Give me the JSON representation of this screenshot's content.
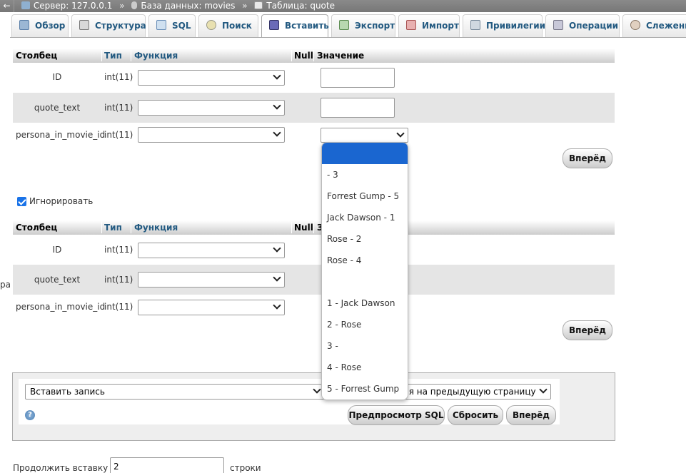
{
  "topbar": {
    "back": "←",
    "server": "Сервер: 127.0.0.1",
    "database": "База данных: movies",
    "table": "Таблица: quote",
    "sep": "»"
  },
  "tabs": [
    {
      "label": "Обзор",
      "icon": "browse-icon"
    },
    {
      "label": "Структура",
      "icon": "structure-icon"
    },
    {
      "label": "SQL",
      "icon": "sql-icon"
    },
    {
      "label": "Поиск",
      "icon": "search-icon"
    },
    {
      "label": "Вставить",
      "icon": "insert-icon"
    },
    {
      "label": "Экспорт",
      "icon": "export-icon"
    },
    {
      "label": "Импорт",
      "icon": "import-icon"
    },
    {
      "label": "Привилегии",
      "icon": "privileges-icon"
    },
    {
      "label": "Операции",
      "icon": "operations-icon"
    },
    {
      "label": "Слежение",
      "icon": "tracking-icon"
    }
  ],
  "headers": {
    "column": "Столбец",
    "type": "Тип",
    "function": "Функция",
    "null": "Null",
    "value": "Значение",
    "value_partial": "З"
  },
  "form1": {
    "rows": [
      {
        "name": "ID",
        "type": "int(11)"
      },
      {
        "name": "quote_text",
        "type": "int(11)"
      },
      {
        "name": "persona_in_movie_id",
        "type": "int(11)"
      }
    ],
    "go_label": "Вперёд"
  },
  "ignore_label": "Игнорировать",
  "form2": {
    "rows": [
      {
        "name": "ID",
        "type": "int(11)"
      },
      {
        "name": "quote_text",
        "type": "int(11)"
      },
      {
        "name": "persona_in_movie_id",
        "type": "int(11)"
      }
    ],
    "go_label": "Вперёд"
  },
  "dropdown_options": [
    "",
    " - 3",
    "Forrest Gump - 5",
    "Jack Dawson - 1",
    "Rose - 2",
    "Rose - 4",
    "",
    "1 - Jack Dawson",
    "2 - Rose",
    "3 - ",
    "4 - Rose",
    "5 - Forrest Gump"
  ],
  "bottom": {
    "insert_select": "Вставить запись",
    "after_select": "уться на предыдущую страницу",
    "preview_sql": "Предпросмотр SQL",
    "reset": "Сбросить",
    "go": "Вперёд",
    "continue_prefix": "Продолжить вставку с",
    "continue_value": "2",
    "continue_suffix": "строки"
  },
  "side_fragment": "ра",
  "colors": {
    "tab_text": "#235a81",
    "selected_option": "#1a66d0",
    "checkbox": "#1a73e8"
  }
}
